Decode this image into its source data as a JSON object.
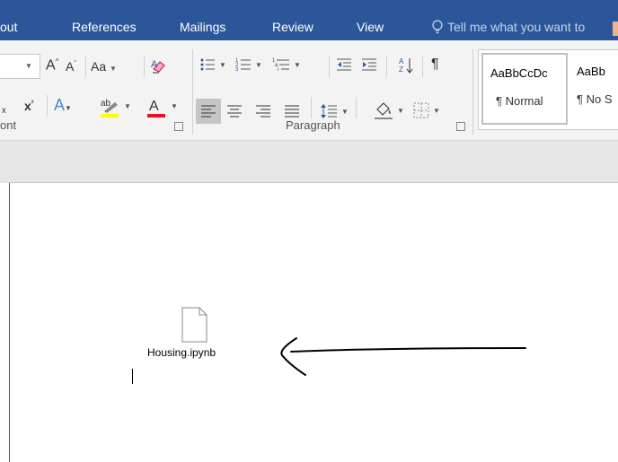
{
  "tabs": [
    "out",
    "References",
    "Mailings",
    "Review",
    "View"
  ],
  "tell_me": "Tell me what you want to",
  "font_group": {
    "label": "ont",
    "change_case": "Aa"
  },
  "paragraph_group": {
    "label": "Paragraph"
  },
  "styles": [
    {
      "sample": "AaBbCcDc",
      "name": "¶ Normal"
    },
    {
      "sample": "AaBb",
      "name": "¶ No S"
    }
  ],
  "document": {
    "attachment_name": "Housing.ipynb"
  },
  "colors": {
    "ribbon_blue": "#2b579a",
    "highlight_yellow": "#ffff00",
    "font_color_red": "#e81123"
  }
}
